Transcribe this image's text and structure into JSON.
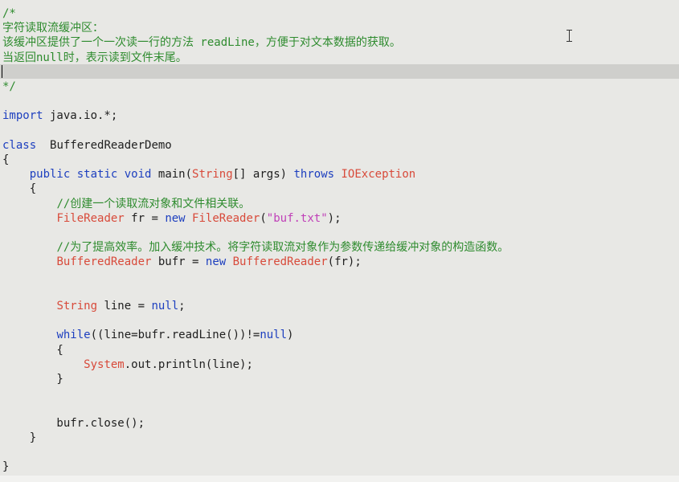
{
  "editor": {
    "lines": [
      [
        {
          "t": "/*",
          "c": "cmt"
        }
      ],
      [
        {
          "t": "字符读取流缓冲区：",
          "c": "cmt"
        }
      ],
      [
        {
          "t": "该缓冲区提供了一个一次读一行的方法 readLine，方便于对文本数据的获取。",
          "c": "cmt"
        }
      ],
      [
        {
          "t": "当返回null时，表示读到文件末尾。",
          "c": "cmt"
        }
      ],
      [],
      [
        {
          "t": "*/",
          "c": "cmt"
        }
      ],
      [],
      [
        {
          "t": "import",
          "c": "kw"
        },
        {
          "t": " java.io.*;",
          "c": "txt"
        }
      ],
      [],
      [
        {
          "t": "class",
          "c": "kw"
        },
        {
          "t": "  BufferedReaderDemo",
          "c": "txt"
        }
      ],
      [
        {
          "t": "{",
          "c": "txt"
        }
      ],
      [
        {
          "t": "    ",
          "c": "txt"
        },
        {
          "t": "public",
          "c": "kw"
        },
        {
          "t": " ",
          "c": "txt"
        },
        {
          "t": "static",
          "c": "kw"
        },
        {
          "t": " ",
          "c": "txt"
        },
        {
          "t": "void",
          "c": "kw"
        },
        {
          "t": " main(",
          "c": "txt"
        },
        {
          "t": "String",
          "c": "cls"
        },
        {
          "t": "[] args) ",
          "c": "txt"
        },
        {
          "t": "throws",
          "c": "kw"
        },
        {
          "t": " ",
          "c": "txt"
        },
        {
          "t": "IOException",
          "c": "cls"
        }
      ],
      [
        {
          "t": "    {",
          "c": "txt"
        }
      ],
      [
        {
          "t": "        ",
          "c": "txt"
        },
        {
          "t": "//创建一个读取流对象和文件相关联。",
          "c": "cmt"
        }
      ],
      [
        {
          "t": "        ",
          "c": "txt"
        },
        {
          "t": "FileReader",
          "c": "cls"
        },
        {
          "t": " fr = ",
          "c": "txt"
        },
        {
          "t": "new",
          "c": "kw"
        },
        {
          "t": " ",
          "c": "txt"
        },
        {
          "t": "FileReader",
          "c": "cls"
        },
        {
          "t": "(",
          "c": "txt"
        },
        {
          "t": "\"buf.txt\"",
          "c": "str"
        },
        {
          "t": ");",
          "c": "txt"
        }
      ],
      [],
      [
        {
          "t": "        ",
          "c": "txt"
        },
        {
          "t": "//为了提高效率。加入缓冲技术。将字符读取流对象作为参数传递给缓冲对象的构造函数。",
          "c": "cmt"
        }
      ],
      [
        {
          "t": "        ",
          "c": "txt"
        },
        {
          "t": "BufferedReader",
          "c": "cls"
        },
        {
          "t": " bufr = ",
          "c": "txt"
        },
        {
          "t": "new",
          "c": "kw"
        },
        {
          "t": " ",
          "c": "txt"
        },
        {
          "t": "BufferedReader",
          "c": "cls"
        },
        {
          "t": "(fr);",
          "c": "txt"
        }
      ],
      [],
      [],
      [
        {
          "t": "        ",
          "c": "txt"
        },
        {
          "t": "String",
          "c": "cls"
        },
        {
          "t": " line = ",
          "c": "txt"
        },
        {
          "t": "null",
          "c": "kw"
        },
        {
          "t": ";",
          "c": "txt"
        }
      ],
      [],
      [
        {
          "t": "        ",
          "c": "txt"
        },
        {
          "t": "while",
          "c": "kw"
        },
        {
          "t": "((line=bufr.readLine())!=",
          "c": "txt"
        },
        {
          "t": "null",
          "c": "kw"
        },
        {
          "t": ")",
          "c": "txt"
        }
      ],
      [
        {
          "t": "        {",
          "c": "txt"
        }
      ],
      [
        {
          "t": "            ",
          "c": "txt"
        },
        {
          "t": "System",
          "c": "cls"
        },
        {
          "t": ".out.println(line);",
          "c": "txt"
        }
      ],
      [
        {
          "t": "        }",
          "c": "txt"
        }
      ],
      [],
      [],
      [
        {
          "t": "        bufr.close();",
          "c": "txt"
        }
      ],
      [
        {
          "t": "    }",
          "c": "txt"
        }
      ],
      [],
      [
        {
          "t": "}",
          "c": "txt"
        }
      ]
    ],
    "colors": {
      "background": "#e8e8e5",
      "current_line": "#cfcfcc",
      "comment": "#2e8b2e",
      "keyword": "#1d3fbf",
      "class_name": "#d84a3a",
      "string": "#c040b8",
      "text": "#202020"
    }
  }
}
